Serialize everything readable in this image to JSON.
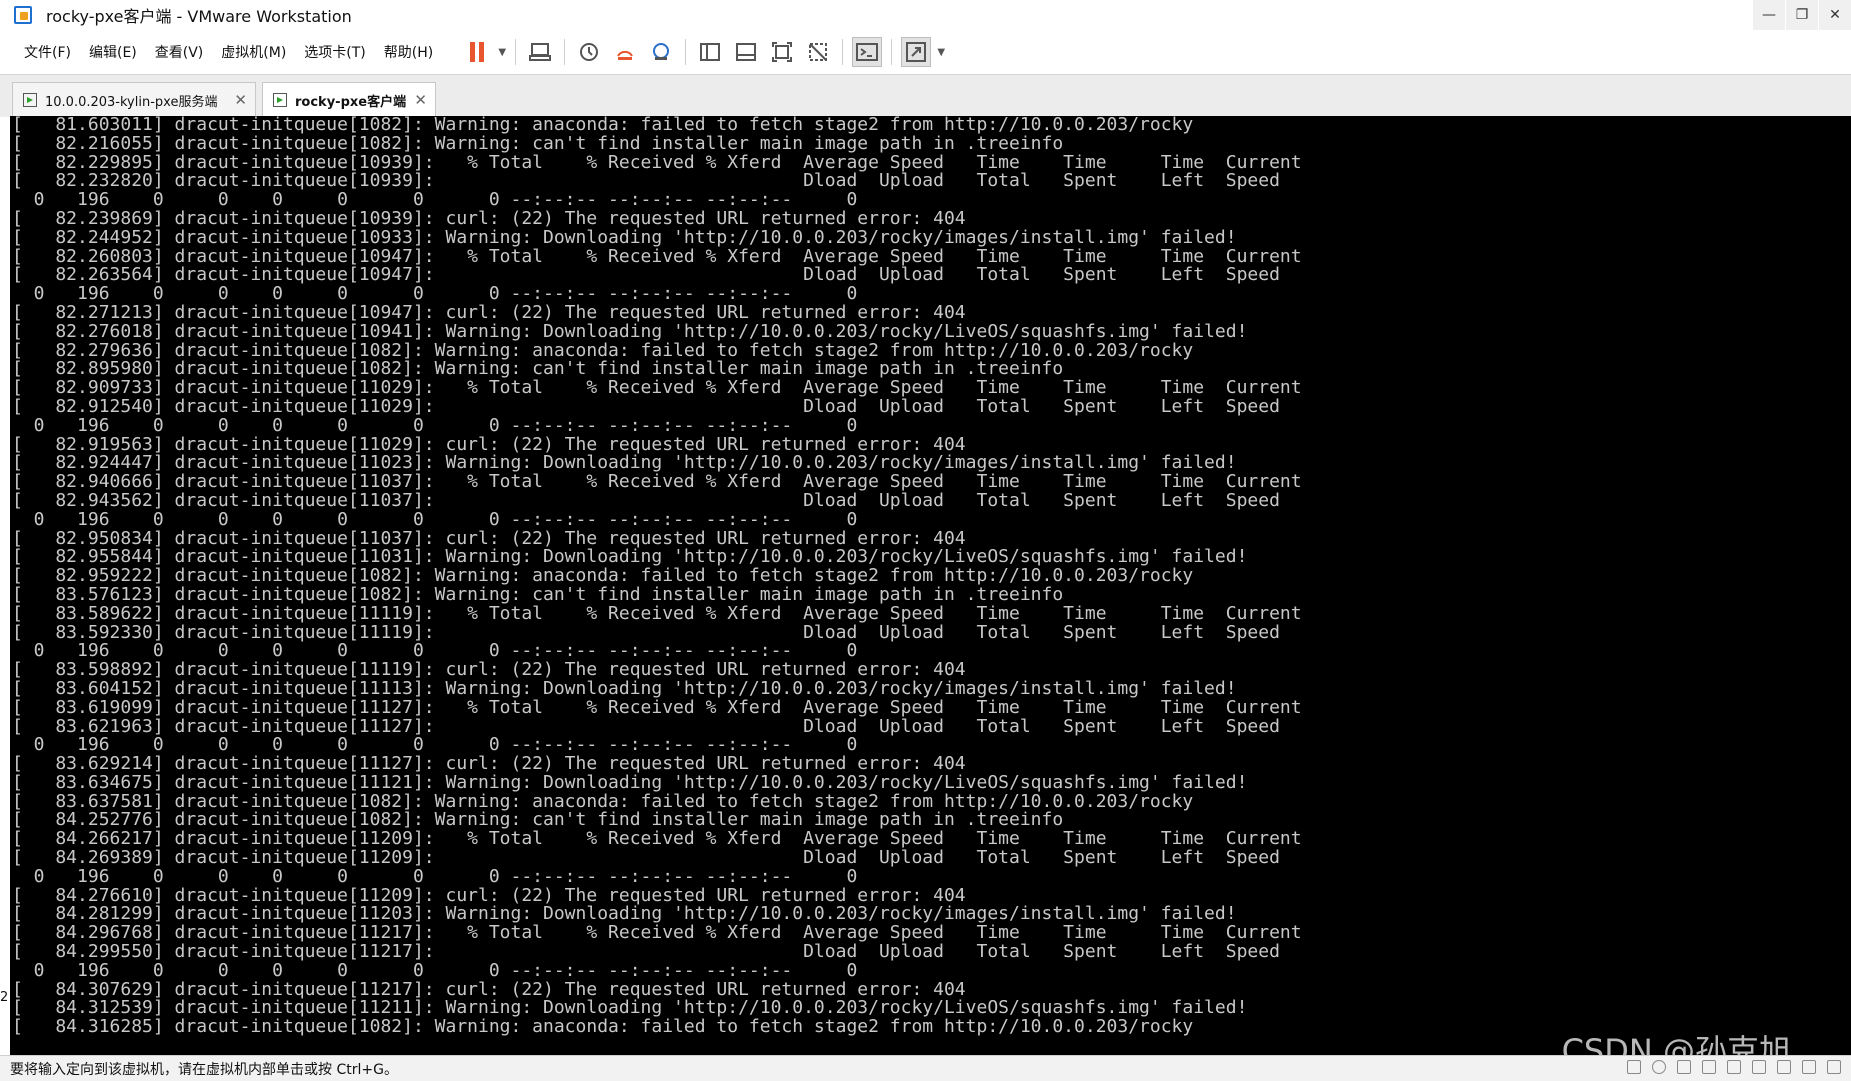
{
  "window": {
    "title": "rocky-pxe客户端 - VMware Workstation",
    "controls": {
      "minimize": "—",
      "restore": "❐",
      "close": "✕"
    }
  },
  "menu": [
    "文件(F)",
    "编辑(E)",
    "查看(V)",
    "虚拟机(M)",
    "选项卡(T)",
    "帮助(H)"
  ],
  "toolbar_icons": [
    "pause-icon",
    "send-ctrl-alt-del-icon",
    "snapshot-icon",
    "revert-snapshot-icon",
    "snapshot-manager-icon",
    "library-view-icon",
    "thumbnail-view-icon",
    "fullscreen-icon",
    "unity-icon",
    "console-view-icon",
    "stretch-view-icon"
  ],
  "tabs": [
    {
      "label": "10.0.0.203-kylin-pxe服务端",
      "active": false
    },
    {
      "label": "rocky-pxe客户端",
      "active": true
    }
  ],
  "console": {
    "lines": [
      "[   81.603011] dracut-initqueue[1082]: Warning: anaconda: failed to fetch stage2 from http://10.0.0.203/rocky",
      "[   82.216055] dracut-initqueue[1082]: Warning: can't find installer main image path in .treeinfo",
      "[   82.229895] dracut-initqueue[10939]:   % Total    % Received % Xferd  Average Speed   Time    Time     Time  Current",
      "[   82.232820] dracut-initqueue[10939]:                                  Dload  Upload   Total   Spent    Left  Speed",
      "  0   196    0     0    0     0      0      0 --:--:-- --:--:-- --:--:--     0",
      "[   82.239869] dracut-initqueue[10939]: curl: (22) The requested URL returned error: 404",
      "[   82.244952] dracut-initqueue[10933]: Warning: Downloading 'http://10.0.0.203/rocky/images/install.img' failed!",
      "[   82.260803] dracut-initqueue[10947]:   % Total    % Received % Xferd  Average Speed   Time    Time     Time  Current",
      "[   82.263564] dracut-initqueue[10947]:                                  Dload  Upload   Total   Spent    Left  Speed",
      "  0   196    0     0    0     0      0      0 --:--:-- --:--:-- --:--:--     0",
      "[   82.271213] dracut-initqueue[10947]: curl: (22) The requested URL returned error: 404",
      "[   82.276018] dracut-initqueue[10941]: Warning: Downloading 'http://10.0.0.203/rocky/LiveOS/squashfs.img' failed!",
      "[   82.279636] dracut-initqueue[1082]: Warning: anaconda: failed to fetch stage2 from http://10.0.0.203/rocky",
      "[   82.895980] dracut-initqueue[1082]: Warning: can't find installer main image path in .treeinfo",
      "[   82.909733] dracut-initqueue[11029]:   % Total    % Received % Xferd  Average Speed   Time    Time     Time  Current",
      "[   82.912540] dracut-initqueue[11029]:                                  Dload  Upload   Total   Spent    Left  Speed",
      "  0   196    0     0    0     0      0      0 --:--:-- --:--:-- --:--:--     0",
      "[   82.919563] dracut-initqueue[11029]: curl: (22) The requested URL returned error: 404",
      "[   82.924447] dracut-initqueue[11023]: Warning: Downloading 'http://10.0.0.203/rocky/images/install.img' failed!",
      "[   82.940666] dracut-initqueue[11037]:   % Total    % Received % Xferd  Average Speed   Time    Time     Time  Current",
      "[   82.943562] dracut-initqueue[11037]:                                  Dload  Upload   Total   Spent    Left  Speed",
      "  0   196    0     0    0     0      0      0 --:--:-- --:--:-- --:--:--     0",
      "[   82.950834] dracut-initqueue[11037]: curl: (22) The requested URL returned error: 404",
      "[   82.955844] dracut-initqueue[11031]: Warning: Downloading 'http://10.0.0.203/rocky/LiveOS/squashfs.img' failed!",
      "[   82.959222] dracut-initqueue[1082]: Warning: anaconda: failed to fetch stage2 from http://10.0.0.203/rocky",
      "[   83.576123] dracut-initqueue[1082]: Warning: can't find installer main image path in .treeinfo",
      "[   83.589622] dracut-initqueue[11119]:   % Total    % Received % Xferd  Average Speed   Time    Time     Time  Current",
      "[   83.592330] dracut-initqueue[11119]:                                  Dload  Upload   Total   Spent    Left  Speed",
      "  0   196    0     0    0     0      0      0 --:--:-- --:--:-- --:--:--     0",
      "[   83.598892] dracut-initqueue[11119]: curl: (22) The requested URL returned error: 404",
      "[   83.604152] dracut-initqueue[11113]: Warning: Downloading 'http://10.0.0.203/rocky/images/install.img' failed!",
      "[   83.619099] dracut-initqueue[11127]:   % Total    % Received % Xferd  Average Speed   Time    Time     Time  Current",
      "[   83.621963] dracut-initqueue[11127]:                                  Dload  Upload   Total   Spent    Left  Speed",
      "  0   196    0     0    0     0      0      0 --:--:-- --:--:-- --:--:--     0",
      "[   83.629214] dracut-initqueue[11127]: curl: (22) The requested URL returned error: 404",
      "[   83.634675] dracut-initqueue[11121]: Warning: Downloading 'http://10.0.0.203/rocky/LiveOS/squashfs.img' failed!",
      "[   83.637581] dracut-initqueue[1082]: Warning: anaconda: failed to fetch stage2 from http://10.0.0.203/rocky",
      "[   84.252776] dracut-initqueue[1082]: Warning: can't find installer main image path in .treeinfo",
      "[   84.266217] dracut-initqueue[11209]:   % Total    % Received % Xferd  Average Speed   Time    Time     Time  Current",
      "[   84.269389] dracut-initqueue[11209]:                                  Dload  Upload   Total   Spent    Left  Speed",
      "  0   196    0     0    0     0      0      0 --:--:-- --:--:-- --:--:--     0",
      "[   84.276610] dracut-initqueue[11209]: curl: (22) The requested URL returned error: 404",
      "[   84.281299] dracut-initqueue[11203]: Warning: Downloading 'http://10.0.0.203/rocky/images/install.img' failed!",
      "[   84.296768] dracut-initqueue[11217]:   % Total    % Received % Xferd  Average Speed   Time    Time     Time  Current",
      "[   84.299550] dracut-initqueue[11217]:                                  Dload  Upload   Total   Spent    Left  Speed",
      "  0   196    0     0    0     0      0      0 --:--:-- --:--:-- --:--:--     0",
      "[   84.307629] dracut-initqueue[11217]: curl: (22) The requested URL returned error: 404",
      "[   84.312539] dracut-initqueue[11211]: Warning: Downloading 'http://10.0.0.203/rocky/LiveOS/squashfs.img' failed!",
      "[   84.316285] dracut-initqueue[1082]: Warning: anaconda: failed to fetch stage2 from http://10.0.0.203/rocky"
    ]
  },
  "status": {
    "message": "要将输入定向到该虚拟机，请在虚拟机内部单击或按 Ctrl+G。",
    "left_marker": "2"
  },
  "watermark": "CSDN @孙克旭",
  "colors": {
    "console_bg": "#000000",
    "console_fg": "#c8c8c8",
    "pause_accent": "#e8552f"
  }
}
